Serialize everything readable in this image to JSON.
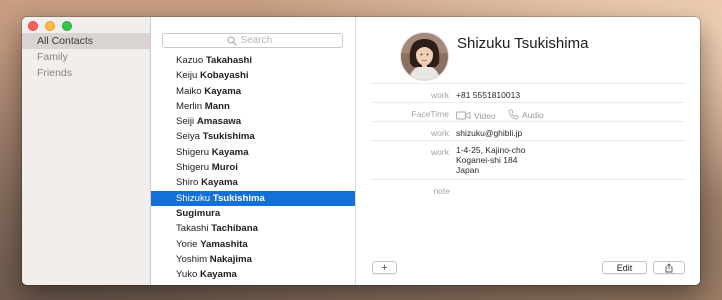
{
  "sidebar": {
    "groups": [
      {
        "label": "All Contacts",
        "selected": true
      },
      {
        "label": "Family",
        "selected": false
      },
      {
        "label": "Friends",
        "selected": false
      }
    ]
  },
  "search": {
    "placeholder": "Search"
  },
  "contacts": [
    {
      "first": "Kazuo",
      "last": "Takahashi"
    },
    {
      "first": "Keiju",
      "last": "Kobayashi"
    },
    {
      "first": "Maiko",
      "last": "Kayama"
    },
    {
      "first": "Merlin",
      "last": "Mann"
    },
    {
      "first": "Seiji",
      "last": "Amasawa"
    },
    {
      "first": "Seiya",
      "last": "Tsukishima"
    },
    {
      "first": "Shigeru",
      "last": "Kayama"
    },
    {
      "first": "Shigeru",
      "last": "Muroi"
    },
    {
      "first": "Shiro",
      "last": "Kayama"
    },
    {
      "first": "Shizuku",
      "last": "Tsukishima",
      "selected": true
    },
    {
      "first": "",
      "last": "Sugimura"
    },
    {
      "first": "Takashi",
      "last": "Tachibana"
    },
    {
      "first": "Yorie",
      "last": "Yamashita"
    },
    {
      "first": "Yoshim",
      "last": "Nakajima"
    },
    {
      "first": "Yuko",
      "last": "Kayama"
    }
  ],
  "detail": {
    "name": "Shizuku Tsukishima",
    "phone": {
      "label": "work",
      "value": "+81 5551810013"
    },
    "facetime": {
      "label": "FaceTime",
      "video": "Video",
      "audio": "Audio"
    },
    "email": {
      "label": "work",
      "value": "shizuku@ghibli.jp"
    },
    "address": {
      "label": "work",
      "lines": [
        "1-4-25, Kajino-cho",
        "Koganei-shi 184",
        "Japan"
      ]
    },
    "note": {
      "label": "note",
      "value": ""
    }
  },
  "footer": {
    "add_label": "+",
    "edit_label": "Edit",
    "share_icon": "share-icon"
  },
  "colors": {
    "selection": "#1470d6",
    "sidebar_bg": "#f1eeec"
  }
}
